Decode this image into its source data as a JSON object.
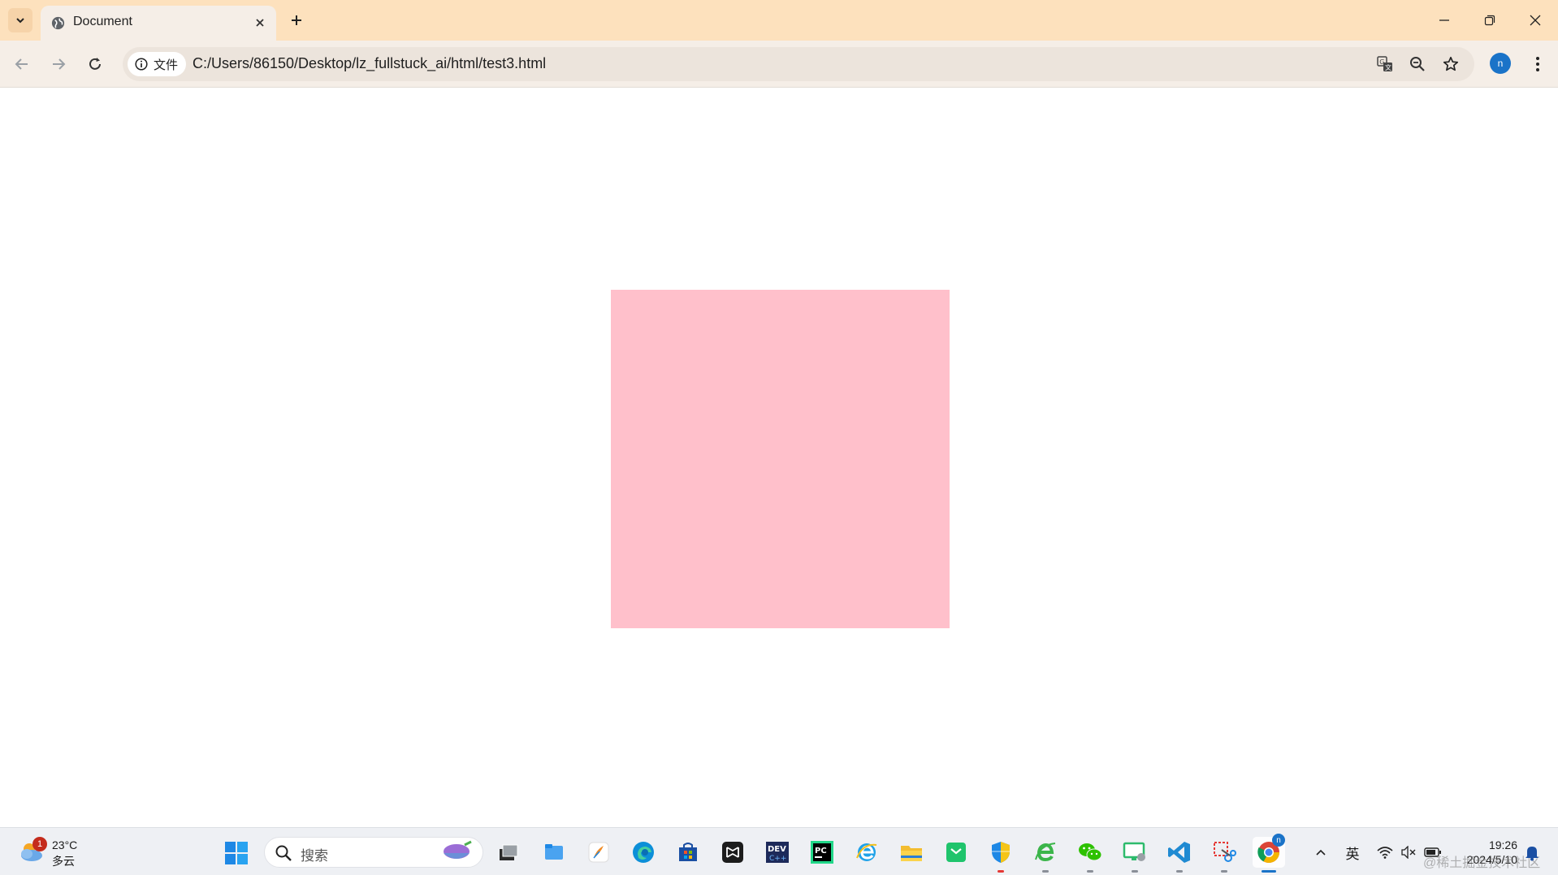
{
  "browser": {
    "tab_title": "Document",
    "site_chip_label": "文件",
    "url": "C:/Users/86150/Desktop/lz_fullstuck_ai/html/test3.html",
    "profile_initial": "n"
  },
  "page": {
    "box_color": "#ffc0cb"
  },
  "taskbar": {
    "weather_badge": "1",
    "temperature": "23°C",
    "condition": "多云",
    "search_placeholder": "搜索",
    "ime_label": "英",
    "time": "19:26",
    "date": "2024/5/10",
    "watermark": "@稀土掘金技术社区",
    "chrome_badge": "n",
    "apps": [
      "task-view",
      "explorer-folder",
      "feather",
      "edge",
      "store",
      "capcut",
      "devcpp",
      "pycharm",
      "ie",
      "file-explorer",
      "green-app",
      "security-shield",
      "e-browser",
      "wechat",
      "remote-desktop",
      "vscode",
      "snipping-tool",
      "chrome"
    ]
  },
  "colors": {
    "tabstrip": "#fde1bd",
    "toolbar": "#f5eee7",
    "accent": "#1a73c8"
  }
}
